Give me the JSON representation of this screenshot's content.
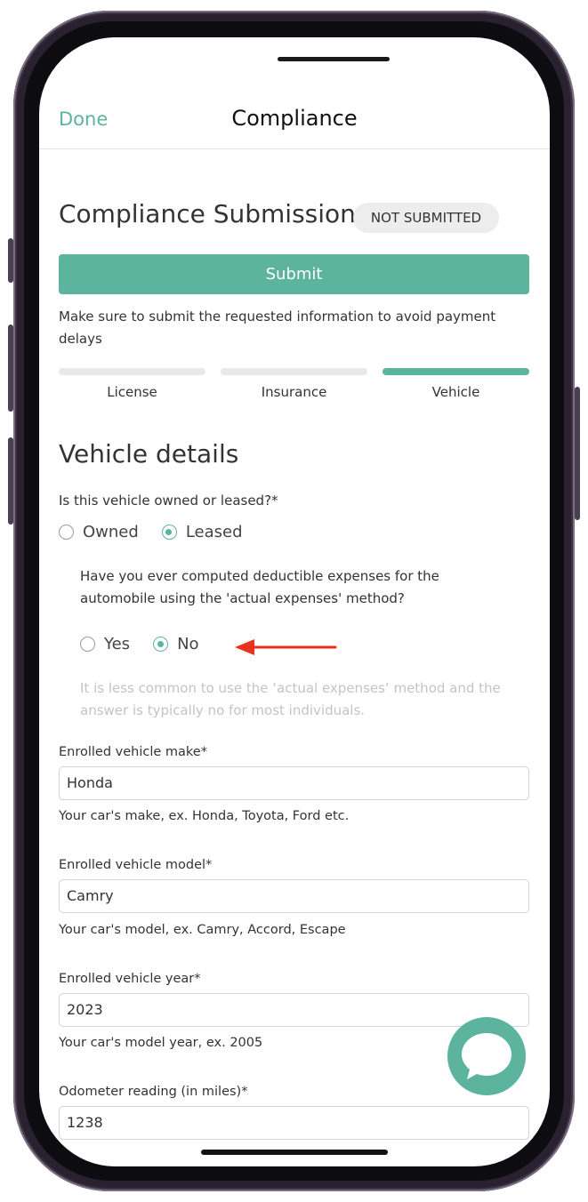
{
  "nav": {
    "done_label": "Done",
    "title": "Compliance"
  },
  "submission": {
    "title": "Compliance Submission",
    "status_badge": "NOT SUBMITTED",
    "submit_label": "Submit",
    "hint": "Make sure to submit the requested information to avoid payment delays"
  },
  "steps": [
    {
      "label": "License",
      "active": false
    },
    {
      "label": "Insurance",
      "active": false
    },
    {
      "label": "Vehicle",
      "active": true
    }
  ],
  "vehicle": {
    "section_title": "Vehicle details",
    "ownership_question": "Is this vehicle owned or leased?*",
    "ownership_options": [
      {
        "label": "Owned",
        "checked": false
      },
      {
        "label": "Leased",
        "checked": true
      }
    ],
    "expenses_question": "Have you ever computed deductible expenses for the automobile using the 'actual expenses' method?",
    "expenses_options": [
      {
        "label": "Yes",
        "checked": false
      },
      {
        "label": "No",
        "checked": true
      }
    ],
    "expenses_note": "It is less common to use the ‘actual expenses‘ method and the answer is typically no for most individuals."
  },
  "fields": {
    "make": {
      "label": "Enrolled vehicle make*",
      "value": "Honda",
      "help": "Your car's make, ex. Honda, Toyota, Ford etc."
    },
    "model": {
      "label": "Enrolled vehicle model*",
      "value": "Camry",
      "help": "Your car's model, ex. Camry, Accord, Escape"
    },
    "year": {
      "label": "Enrolled vehicle year*",
      "value": "2023",
      "help": "Your car's model year, ex. 2005"
    },
    "odometer": {
      "label": "Odometer reading (in miles)*",
      "value": "1238"
    }
  },
  "colors": {
    "accent": "#5cb39e",
    "arrow": "#e8321f",
    "badge_bg": "#ededed"
  },
  "icons": {
    "chat": "chat-bubble-icon",
    "annotation_arrow": "arrow-left-icon"
  }
}
